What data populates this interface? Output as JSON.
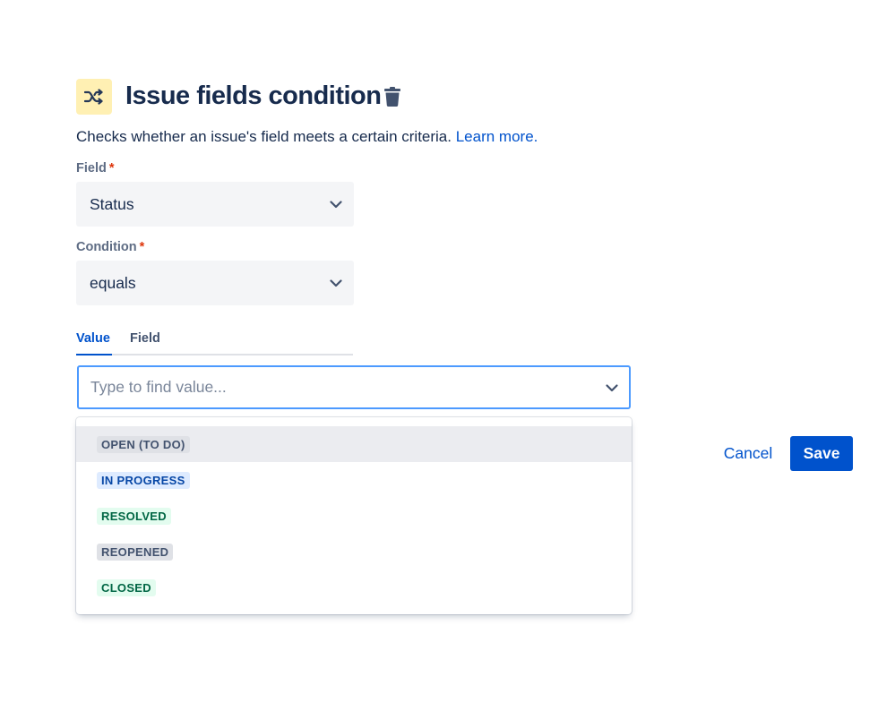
{
  "header": {
    "icon": "shuffle-icon",
    "icon_bg": "#fff0b3",
    "title": "Issue fields condition",
    "delete_icon": "trash-icon"
  },
  "description": {
    "text": "Checks whether an issue's field meets a certain criteria.",
    "link_text": "Learn more."
  },
  "field": {
    "label": "Field",
    "required_mark": "*",
    "value": "Status"
  },
  "condition": {
    "label": "Condition",
    "required_mark": "*",
    "value": "equals"
  },
  "tabs": [
    {
      "label": "Value",
      "active": true
    },
    {
      "label": "Field",
      "active": false
    }
  ],
  "value_input": {
    "placeholder": "Type to find value..."
  },
  "options": [
    {
      "label": "OPEN (TO DO)",
      "color": "grey",
      "highlighted": true
    },
    {
      "label": "IN PROGRESS",
      "color": "blue",
      "highlighted": false
    },
    {
      "label": "RESOLVED",
      "color": "green",
      "highlighted": false
    },
    {
      "label": "REOPENED",
      "color": "grey",
      "highlighted": false
    },
    {
      "label": "CLOSED",
      "color": "green",
      "highlighted": false
    }
  ],
  "actions": {
    "cancel_label": "Cancel",
    "save_label": "Save"
  },
  "colors": {
    "primary": "#0052cc",
    "focus_border": "#4c9aff",
    "required": "#de350b"
  }
}
